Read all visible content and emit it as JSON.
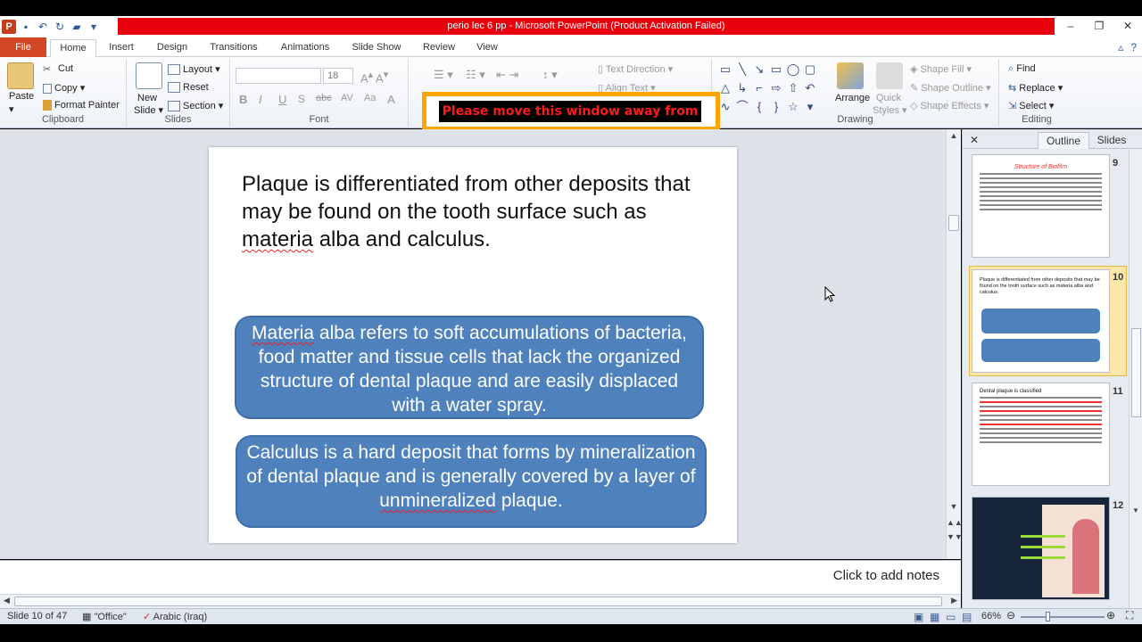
{
  "window": {
    "title": "perio lec 6 pp  -  Microsoft PowerPoint (Product Activation Failed)",
    "controls": {
      "minimize": "–",
      "maximize": "❐",
      "close": "✕"
    }
  },
  "qat": {
    "logo": "P"
  },
  "tabs": {
    "file": "File",
    "home": "Home",
    "insert": "Insert",
    "design": "Design",
    "transitions": "Transitions",
    "animations": "Animations",
    "slideshow": "Slide Show",
    "review": "Review",
    "view": "View"
  },
  "ribbon": {
    "clipboard": {
      "label": "Clipboard",
      "paste": "Paste",
      "cut": "Cut",
      "copy": "Copy",
      "format_painter": "Format Painter"
    },
    "slides": {
      "label": "Slides",
      "new_slide": "New",
      "new_slide2": "Slide",
      "layout": "Layout",
      "reset": "Reset",
      "section": "Section"
    },
    "font": {
      "label": "Font",
      "size": "18"
    },
    "paragraph": {
      "text_direction": "Text Direction",
      "align_text": "Align Text"
    },
    "drawing": {
      "label": "Drawing",
      "arrange": "Arrange",
      "quick_styles": "Quick",
      "quick_styles2": "Styles",
      "shape_fill": "Shape Fill",
      "shape_outline": "Shape Outline",
      "shape_effects": "Shape Effects"
    },
    "editing": {
      "label": "Editing",
      "find": "Find",
      "replace": "Replace",
      "select": "Select"
    }
  },
  "popup": {
    "text": "Please move this window away from"
  },
  "slide": {
    "title_parts": [
      "Plaque is differentiated from other deposits that may be found on the tooth surface such as ",
      "materia",
      " alba and calculus."
    ],
    "box1_parts": [
      "Materia",
      " alba refers to soft accumulations of bacteria, food matter and tissue cells that lack the organized structure of dental plaque and are easily displaced with a water spray."
    ],
    "box2_parts": [
      "Calculus is a hard deposit that forms by mineralization of dental plaque and is generally covered by a layer of ",
      "unmineralized",
      " plaque."
    ]
  },
  "notes": {
    "placeholder": "Click to add notes"
  },
  "panel": {
    "close": "✕",
    "tab_outline": "Outline",
    "tab_slides": "Slides",
    "thumbs": [
      {
        "num": "9",
        "title": "Structure of Biofilm"
      },
      {
        "num": "10",
        "title": "Plaque is differentiated from other deposits that may be found on the tooth surface such as materia alba and calculus."
      },
      {
        "num": "11",
        "title": "Dental plaque is classified"
      },
      {
        "num": "12",
        "title": ""
      }
    ]
  },
  "status": {
    "slide": "Slide 10 of 47",
    "theme": "\"Office\"",
    "language": "Arabic (Iraq)",
    "zoom": "66%"
  },
  "colors": {
    "title_red": "#e8000c",
    "file_tab": "#d24726",
    "box_fill": "#4f81bd",
    "popup_border": "#ffa500"
  }
}
